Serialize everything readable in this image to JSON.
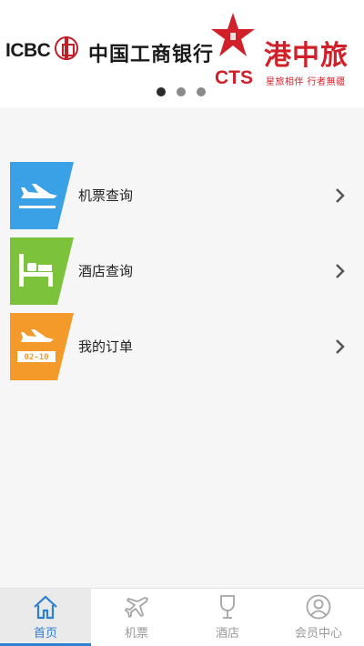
{
  "banner": {
    "icbc_logo": "ICBC",
    "icbc_name": "中国工商银行",
    "cts_letters": "CTS",
    "cts_name": "港中旅",
    "cts_slogan": "星旅相伴 行者無疆",
    "pager": {
      "total": 3,
      "active_index": 0
    }
  },
  "menu": [
    {
      "label": "机票查询",
      "icon": "plane-departure-icon",
      "color": "#3aa1e6"
    },
    {
      "label": "酒店查询",
      "icon": "hotel-bed-icon",
      "color": "#7cc23a"
    },
    {
      "label": "我的订单",
      "icon": "order-ticket-icon",
      "color": "#f39a2b",
      "icon_text": "02-10"
    }
  ],
  "tabbar": {
    "tabs": [
      {
        "label": "首页",
        "icon": "home-icon",
        "active": true
      },
      {
        "label": "机票",
        "icon": "plane-icon",
        "active": false
      },
      {
        "label": "酒店",
        "icon": "glass-icon",
        "active": false
      },
      {
        "label": "会员中心",
        "icon": "user-icon",
        "active": false
      }
    ],
    "active_color": "#2d7fd0",
    "inactive_color": "#9a9a9a"
  }
}
